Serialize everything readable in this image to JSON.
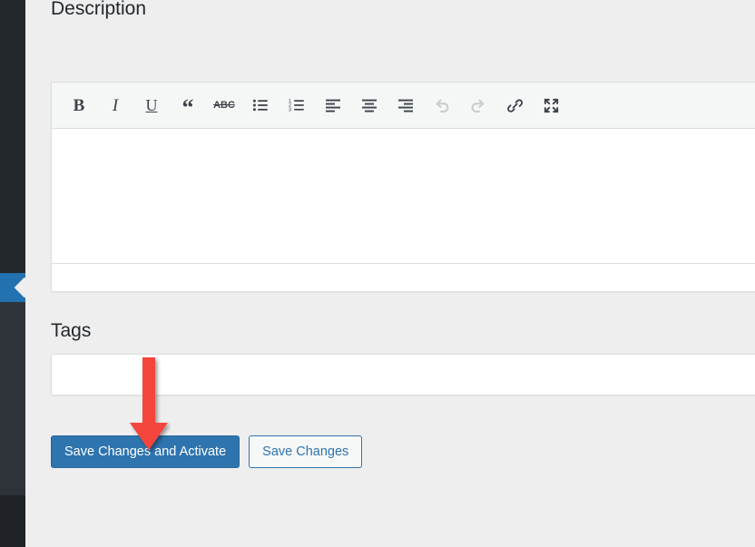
{
  "sidebar": {
    "collapse_handle_label": "Collapse menu",
    "collapse_icon": "chevron-left-icon",
    "accent_color": "#2271b1",
    "background_color": "#23282d"
  },
  "page": {
    "background_color": "#eeeeee"
  },
  "description_section": {
    "heading": "Description",
    "editor": {
      "content": "",
      "toolbar": [
        {
          "name": "bold-icon",
          "label": "Bold",
          "glyph": "B",
          "disabled": false
        },
        {
          "name": "italic-icon",
          "label": "Italic",
          "glyph": "I",
          "disabled": false
        },
        {
          "name": "underline-icon",
          "label": "Underline",
          "glyph": "U",
          "disabled": false
        },
        {
          "name": "blockquote-icon",
          "label": "Blockquote",
          "glyph": "“",
          "disabled": false
        },
        {
          "name": "strikethrough-icon",
          "label": "Strikethrough",
          "glyph": "ABC",
          "disabled": false
        },
        {
          "name": "bulleted-list-icon",
          "label": "Bulleted list",
          "glyph": "",
          "disabled": false
        },
        {
          "name": "numbered-list-icon",
          "label": "Numbered list",
          "glyph": "",
          "disabled": false
        },
        {
          "name": "align-left-icon",
          "label": "Align left",
          "glyph": "",
          "disabled": false
        },
        {
          "name": "align-center-icon",
          "label": "Align center",
          "glyph": "",
          "disabled": false
        },
        {
          "name": "align-right-icon",
          "label": "Align right",
          "glyph": "",
          "disabled": false
        },
        {
          "name": "undo-icon",
          "label": "Undo",
          "glyph": "",
          "disabled": true
        },
        {
          "name": "redo-icon",
          "label": "Redo",
          "glyph": "",
          "disabled": true
        },
        {
          "name": "link-icon",
          "label": "Insert/edit link",
          "glyph": "",
          "disabled": false
        },
        {
          "name": "fullscreen-icon",
          "label": "Fullscreen",
          "glyph": "",
          "disabled": false
        }
      ],
      "statusbar_text": ""
    }
  },
  "tags_section": {
    "heading": "Tags",
    "input_value": "",
    "input_placeholder": ""
  },
  "actions": {
    "primary_label": "Save Changes and Activate",
    "secondary_label": "Save Changes",
    "primary_color": "#2e74ae",
    "secondary_text_color": "#2e74ae"
  },
  "annotation": {
    "type": "arrow",
    "direction": "down",
    "color": "#f4443c",
    "points_at": "Save Changes and Activate"
  }
}
